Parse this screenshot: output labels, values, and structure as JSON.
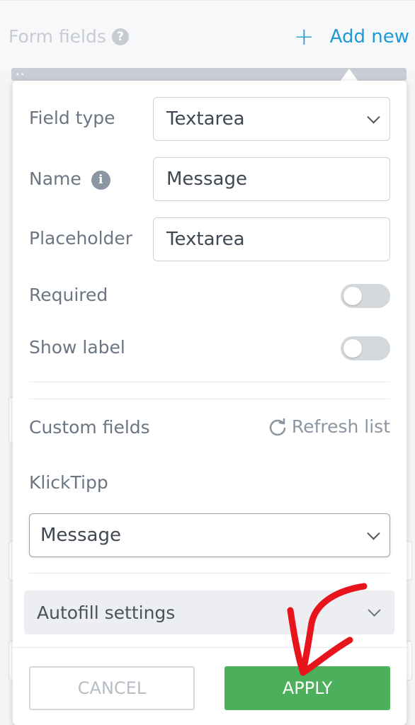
{
  "header": {
    "section_title": "Form fields",
    "help_icon": "?",
    "add_new_icon": "+",
    "add_new_label": "Add new"
  },
  "panel": {
    "field_type": {
      "label": "Field type",
      "value": "Textarea"
    },
    "name": {
      "label": "Name",
      "info_icon": "i",
      "value": "Message"
    },
    "placeholder": {
      "label": "Placeholder",
      "value": "Textarea"
    },
    "required": {
      "label": "Required",
      "enabled": false
    },
    "show_label": {
      "label": "Show label",
      "enabled": false
    },
    "custom_fields": {
      "label": "Custom fields",
      "refresh_label": "Refresh list"
    },
    "klicktipp": {
      "label": "KlickTipp",
      "value": "Message"
    },
    "autofill": {
      "label": "Autofill settings"
    },
    "buttons": {
      "cancel": "CANCEL",
      "apply": "APPLY"
    }
  },
  "colors": {
    "accent": "#1e9ad6",
    "apply_green": "#4caf5b",
    "annotation_red": "#e8141c"
  }
}
